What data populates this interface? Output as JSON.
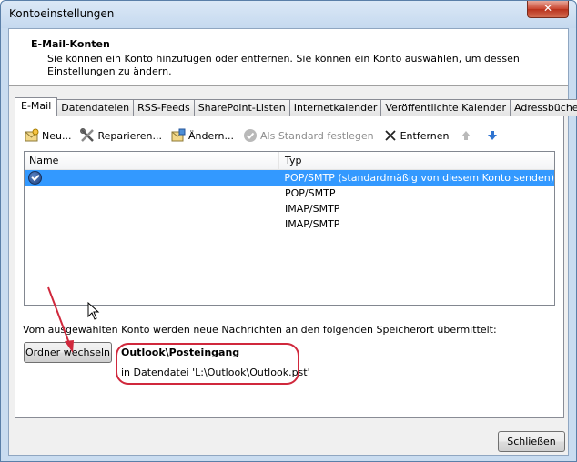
{
  "window": {
    "title": "Kontoeinstellungen",
    "close_glyph": "✕"
  },
  "header": {
    "title": "E-Mail-Konten",
    "description": "Sie können ein Konto hinzufügen oder entfernen. Sie können ein Konto auswählen, um dessen Einstellungen zu ändern."
  },
  "tabs": [
    {
      "label": "E-Mail",
      "active": true
    },
    {
      "label": "Datendateien"
    },
    {
      "label": "RSS-Feeds"
    },
    {
      "label": "SharePoint-Listen"
    },
    {
      "label": "Internetkalender"
    },
    {
      "label": "Veröffentlichte Kalender"
    },
    {
      "label": "Adressbücher"
    }
  ],
  "toolbar": {
    "new_label": "Neu...",
    "repair_label": "Reparieren...",
    "change_label": "Ändern...",
    "default_label": "Als Standard festlegen",
    "remove_label": "Entfernen",
    "icons": [
      "new-account-icon",
      "repair-tools-icon",
      "change-account-icon",
      "default-check-icon",
      "remove-x-icon",
      "move-up-icon",
      "move-down-icon"
    ]
  },
  "list": {
    "columns": {
      "name": "Name",
      "type": "Typ"
    },
    "rows": [
      {
        "name": "",
        "type": "POP/SMTP (standardmäßig von diesem Konto senden)",
        "selected": true
      },
      {
        "name": "",
        "type": "POP/SMTP"
      },
      {
        "name": "",
        "type": "IMAP/SMTP"
      },
      {
        "name": "",
        "type": "IMAP/SMTP"
      }
    ]
  },
  "delivery": {
    "info": "Vom ausgewählten Konto werden neue Nachrichten an den folgenden Speicherort übermittelt:",
    "change_folder_label": "Ordner wechseln",
    "folder": "Outlook\\Posteingang",
    "file": "in Datendatei 'L:\\Outlook\\Outlook.pst'"
  },
  "footer": {
    "close_label": "Schließen"
  },
  "colors": {
    "selection": "#3399ff",
    "annotation": "#d0283c"
  }
}
